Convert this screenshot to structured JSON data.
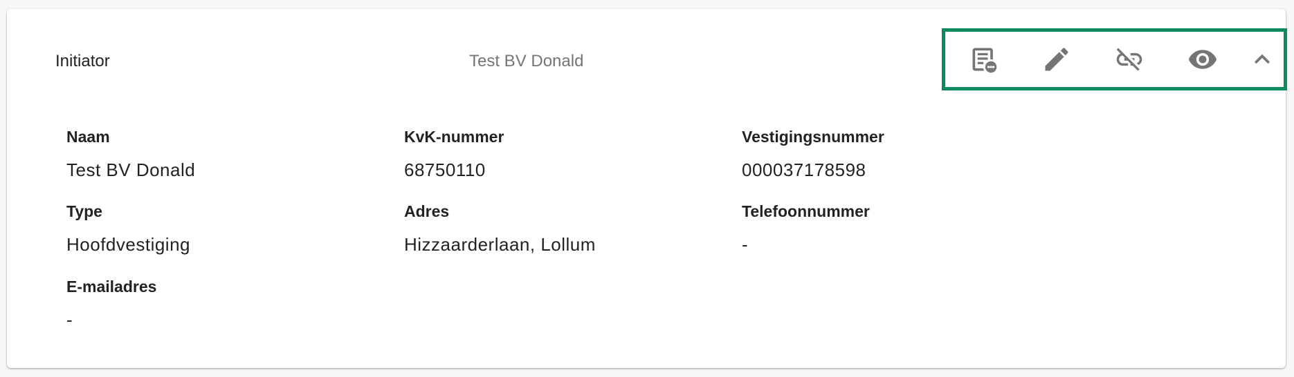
{
  "header": {
    "title": "Initiator",
    "subtitle": "Test BV Donald"
  },
  "actions": [
    {
      "icon": "notes-more-icon"
    },
    {
      "icon": "pencil-icon"
    },
    {
      "icon": "unlink-icon"
    },
    {
      "icon": "eye-icon"
    },
    {
      "icon": "chevron-up-icon"
    }
  ],
  "colors": {
    "highlight_border": "#0b8a5e",
    "icon": "#757575"
  },
  "fields": {
    "naam": {
      "label": "Naam",
      "value": "Test BV Donald"
    },
    "kvk": {
      "label": "KvK-nummer",
      "value": "68750110"
    },
    "vestigingsnummer": {
      "label": "Vestigingsnummer",
      "value": "000037178598"
    },
    "type": {
      "label": "Type",
      "value": "Hoofdvestiging"
    },
    "adres": {
      "label": "Adres",
      "value": "Hizzaarderlaan, Lollum"
    },
    "telefoon": {
      "label": "Telefoonnummer",
      "value": "-"
    },
    "email": {
      "label": "E-mailadres",
      "value": "-"
    }
  }
}
